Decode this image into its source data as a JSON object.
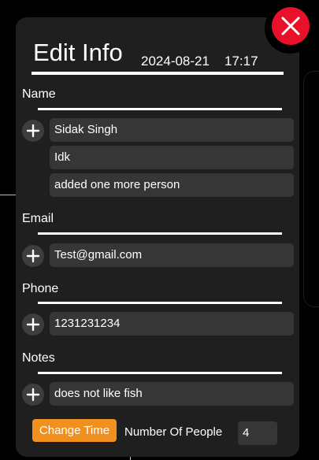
{
  "header": {
    "title": "Edit Info",
    "date": "2024-08-21",
    "time": "17:17"
  },
  "close_icon": "close-x-icon",
  "add_icon": "plus-icon",
  "name": {
    "label": "Name",
    "values": [
      "Sidak Singh",
      "Idk",
      "added one more person"
    ]
  },
  "email": {
    "label": "Email",
    "value": "Test@gmail.com"
  },
  "phone": {
    "label": "Phone",
    "value": "1231231234"
  },
  "notes": {
    "label": "Notes",
    "value": "does not like fish"
  },
  "footer": {
    "change_time_label": "Change Time",
    "people_label": "Number Of People",
    "people_value": "4"
  },
  "colors": {
    "close": "#e9112a",
    "accent": "#f0901f",
    "panel": "#1f1f1f",
    "field": "#363636"
  }
}
